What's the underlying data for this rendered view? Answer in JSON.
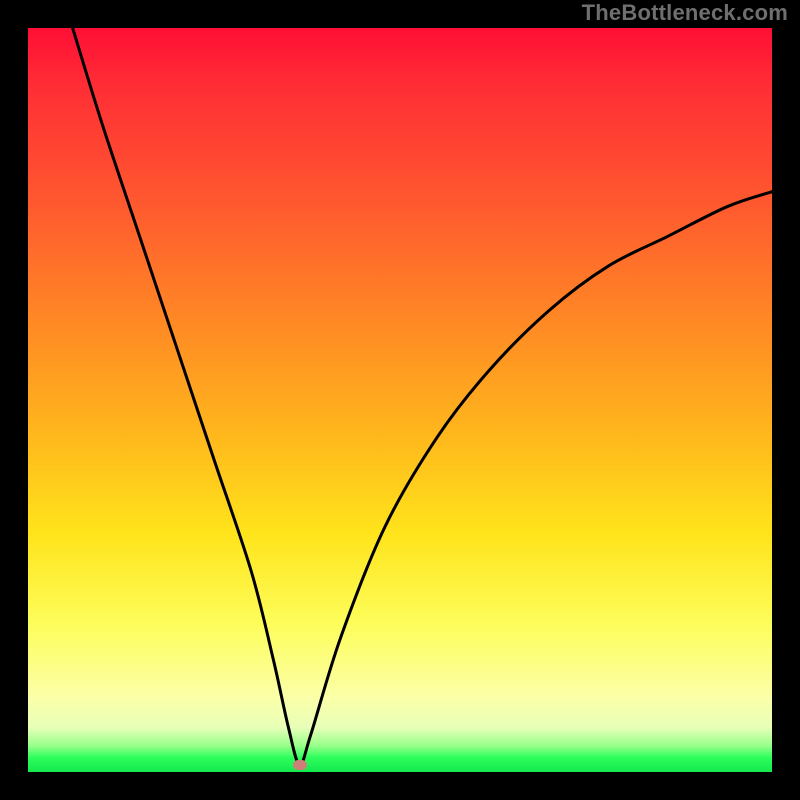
{
  "watermark": "TheBottleneck.com",
  "chart_data": {
    "type": "line",
    "title": "",
    "xlabel": "",
    "ylabel": "",
    "xlim": [
      0,
      100
    ],
    "ylim": [
      0,
      100
    ],
    "grid": false,
    "legend": false,
    "series": [
      {
        "name": "curve",
        "x": [
          6,
          10,
          15,
          20,
          25,
          30,
          33,
          35,
          36.5,
          38,
          42,
          48,
          55,
          62,
          70,
          78,
          86,
          94,
          100
        ],
        "y": [
          100,
          87,
          72,
          57,
          42,
          27,
          15,
          6,
          1,
          5,
          18,
          33,
          45,
          54,
          62,
          68,
          72,
          76,
          78
        ]
      }
    ],
    "marker": {
      "x": 36.5,
      "y": 1
    },
    "background_gradient": {
      "top": "#ff0f35",
      "mid": "#ffe41b",
      "bottom": "#13e84d"
    }
  }
}
